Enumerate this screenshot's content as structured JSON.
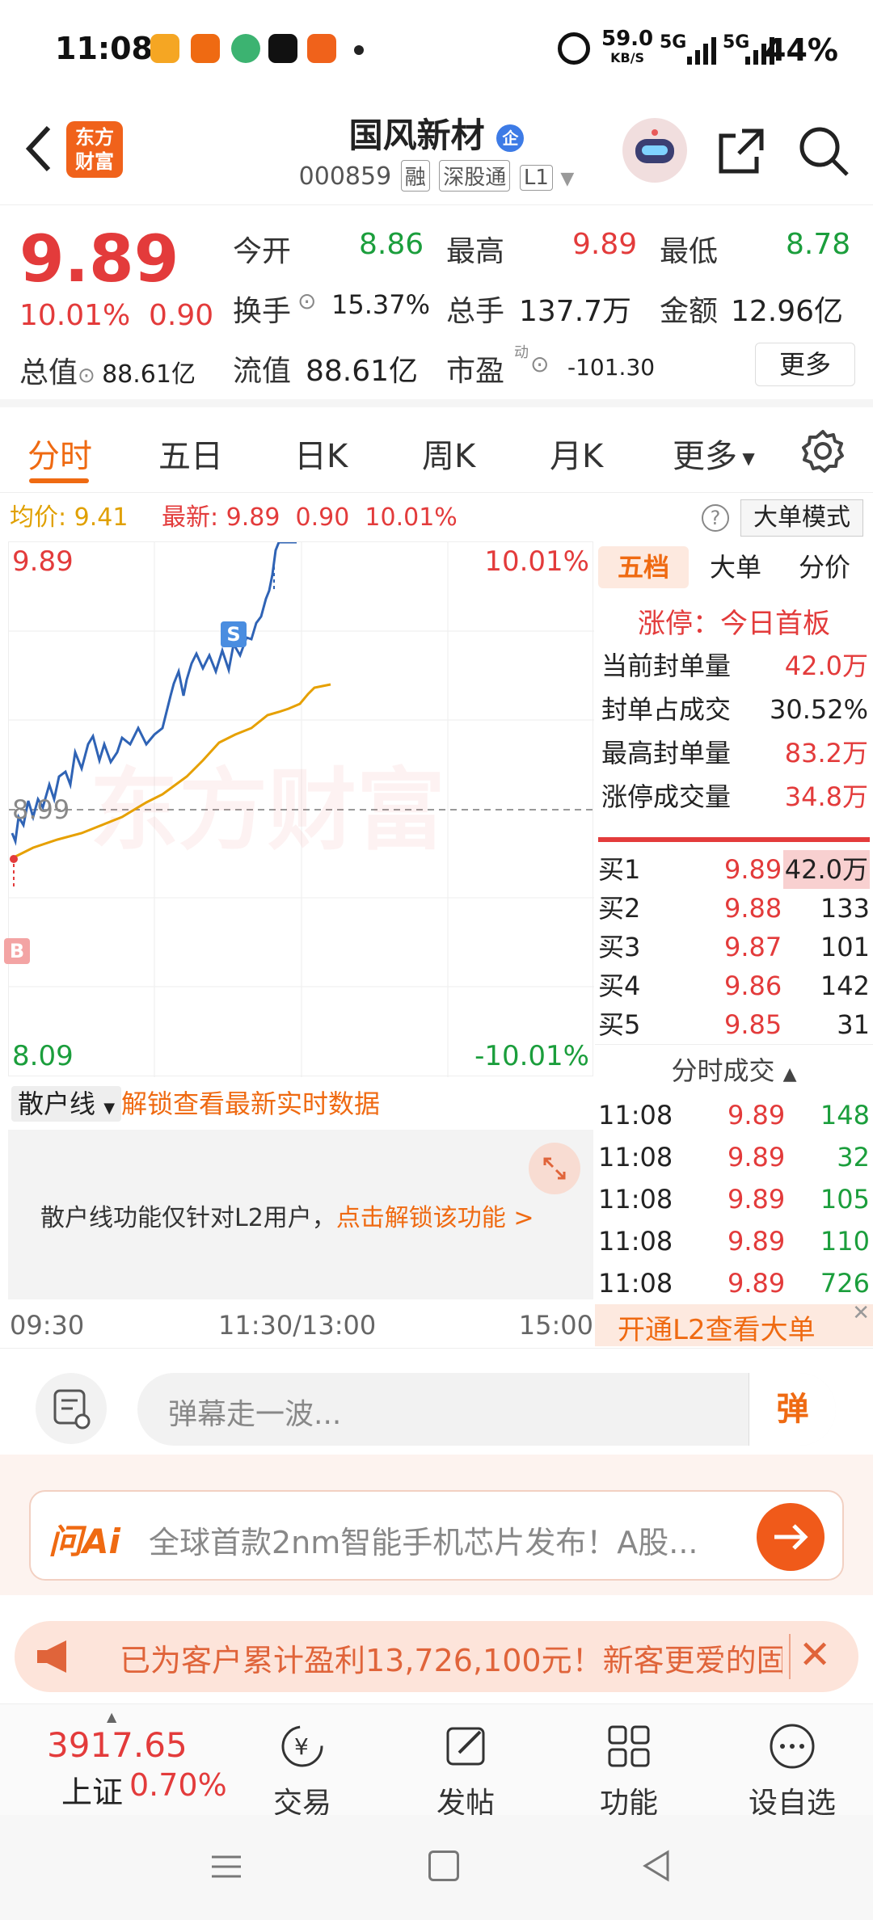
{
  "status_bar": {
    "time": "11:08",
    "speed": "59.0",
    "speed_unit": "KB/S",
    "net1": "5G",
    "net2": "5G",
    "battery": "44%"
  },
  "header": {
    "logo_line1": "东方",
    "logo_line2": "财富",
    "stock_name": "国风新材",
    "badge": "企",
    "code": "000859",
    "tag1": "融",
    "tag2": "深股通",
    "tag3": "L1"
  },
  "quote": {
    "price": "9.89",
    "change_pct": "10.01%",
    "change": "0.90",
    "open_label": "今开",
    "open": "8.86",
    "high_label": "最高",
    "high": "9.89",
    "low_label": "最低",
    "low": "8.78",
    "turnover_label": "换手",
    "turnover": "15.37%",
    "volume_label": "总手",
    "volume": "137.7万",
    "amount_label": "金额",
    "amount": "12.96亿",
    "mcap_label": "总值",
    "mcap": "88.61亿",
    "float_label": "流值",
    "float": "88.61亿",
    "pe_label": "市盈",
    "pe_sup": "动",
    "pe": "-101.30",
    "more": "更多"
  },
  "tabs": [
    "分时",
    "五日",
    "日K",
    "周K",
    "月K",
    "更多"
  ],
  "avg_bar": {
    "avg_label": "均价:",
    "avg": "9.41",
    "latest_label": "最新:",
    "latest": "9.89",
    "chg": "0.90",
    "pct": "10.01%",
    "mode": "大单模式"
  },
  "chart": {
    "top_price": "9.89",
    "top_pct": "10.01%",
    "mid_price": "8.99",
    "bottom_price": "8.09",
    "bottom_pct": "-10.01%",
    "watermark": "东方财富",
    "marker_s": "S",
    "marker_b": "B"
  },
  "right_panel": {
    "tabs": [
      "五档",
      "大单",
      "分价"
    ],
    "limit_title": "涨停：今日首板",
    "stats": [
      {
        "label": "当前封单量",
        "value": "42.0万"
      },
      {
        "label": "封单占成交",
        "value": "30.52%"
      },
      {
        "label": "最高封单量",
        "value": "83.2万"
      },
      {
        "label": "涨停成交量",
        "value": "34.8万"
      }
    ],
    "bids": [
      {
        "label": "买1",
        "price": "9.89",
        "vol": "42.0万"
      },
      {
        "label": "买2",
        "price": "9.88",
        "vol": "133"
      },
      {
        "label": "买3",
        "price": "9.87",
        "vol": "101"
      },
      {
        "label": "买4",
        "price": "9.86",
        "vol": "142"
      },
      {
        "label": "买5",
        "price": "9.85",
        "vol": "31"
      }
    ],
    "ticks_title": "分时成交",
    "ticks": [
      {
        "time": "11:08",
        "price": "9.89",
        "vol": "148"
      },
      {
        "time": "11:08",
        "price": "9.89",
        "vol": "32"
      },
      {
        "time": "11:08",
        "price": "9.89",
        "vol": "105"
      },
      {
        "time": "11:08",
        "price": "9.89",
        "vol": "110"
      },
      {
        "time": "11:08",
        "price": "9.89",
        "vol": "726"
      }
    ],
    "l2_banner": "开通L2查看大单"
  },
  "retail": {
    "select": "散户线",
    "unlock": "解锁查看最新实时数据",
    "box_text": "散户线功能仅针对L2用户，",
    "box_link": "点击解锁该功能 >"
  },
  "time_axis": {
    "start": "09:30",
    "mid": "11:30/13:00",
    "end": "15:00"
  },
  "danmu": {
    "placeholder": "弹幕走一波...",
    "btn": "弹"
  },
  "ask_ai": {
    "brand": "问Ai",
    "text": "全球首款2nm智能手机芯片发布！A股..."
  },
  "promo": {
    "text": "已为客户累计盈利13,726,100元！新客更爱的固"
  },
  "bottom_nav": {
    "index_value": "3917.65",
    "index_name": "上证",
    "index_pct": "0.70%",
    "items": [
      "交易",
      "发帖",
      "功能",
      "设自选"
    ]
  }
}
